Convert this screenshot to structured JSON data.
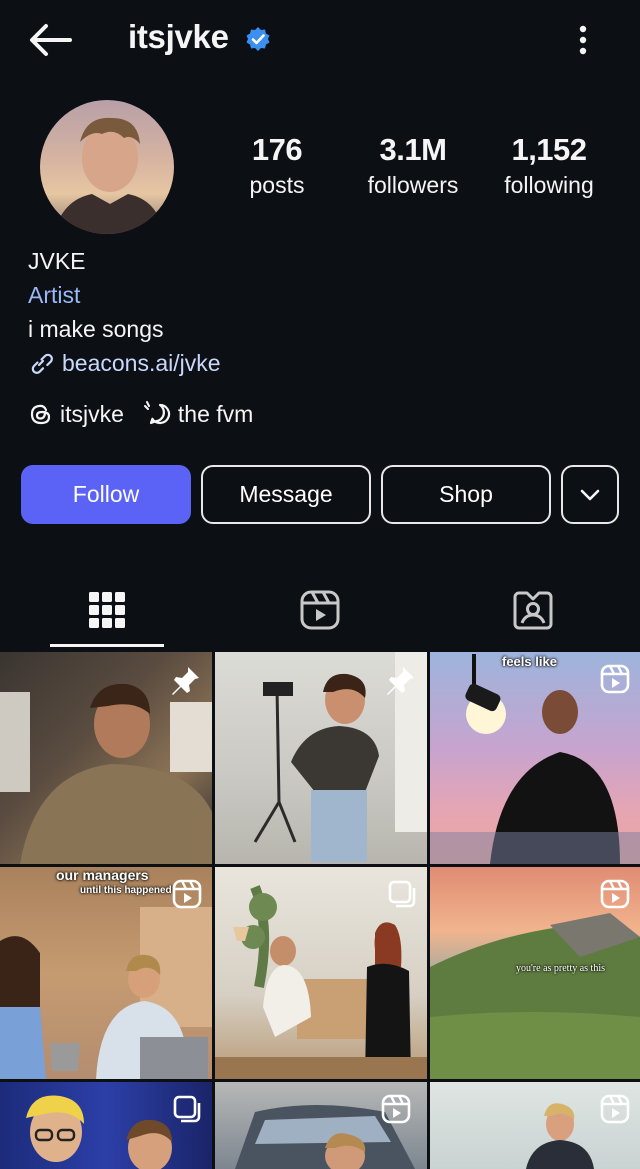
{
  "header": {
    "username": "itsjvke"
  },
  "profile": {
    "stats": [
      {
        "value": "176",
        "label": "posts"
      },
      {
        "value": "3.1M",
        "label": "followers"
      },
      {
        "value": "1,152",
        "label": "following"
      }
    ],
    "name": "JVKE",
    "category": "Artist",
    "bio": "i make songs",
    "link": "beacons.ai/jvke",
    "threads_handle": "itsjvke",
    "channel": "the fvm"
  },
  "actions": {
    "follow": "Follow",
    "message": "Message",
    "shop": "Shop"
  },
  "tabs": [
    "posts-grid-icon",
    "reels-icon",
    "tagged-icon"
  ],
  "posts": [
    {
      "overlay": "pin-icon"
    },
    {
      "overlay": "pin-icon"
    },
    {
      "overlay": "reel-icon",
      "caption": "feels like"
    },
    {
      "overlay": "reel-icon",
      "caption": "our managers",
      "caption2": "until this happened"
    },
    {
      "overlay": "carousel-icon"
    },
    {
      "overlay": "reel-icon",
      "caption": "you're as pretty as this"
    },
    {
      "overlay": "carousel-icon"
    },
    {
      "overlay": "reel-icon"
    },
    {
      "overlay": "reel-icon"
    }
  ],
  "colors": {
    "background": "#0c0f14",
    "follow_button": "#5b63f6",
    "link": "#c9d8fb",
    "category": "#9ab8f5",
    "verified": "#3b8ff0"
  }
}
